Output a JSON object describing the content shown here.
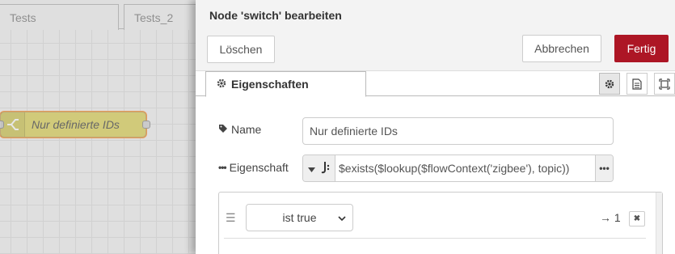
{
  "workspace": {
    "tabs": [
      {
        "label": "Tests"
      },
      {
        "label": "Tests_2"
      }
    ],
    "node": {
      "label": "Nur definierte IDs",
      "icon": "switch-icon"
    }
  },
  "editor": {
    "title": "Node 'switch' bearbeiten",
    "buttons": {
      "delete": "Löschen",
      "cancel": "Abbrechen",
      "done": "Fertig"
    },
    "tab": {
      "label": "Eigenschaften",
      "icon": "gear-icon"
    },
    "side_icons": [
      "gear-icon",
      "document-icon",
      "frame-icon"
    ],
    "fields": {
      "name": {
        "label": "Name",
        "icon": "tag-icon",
        "value": "Nur definierte IDs"
      },
      "property": {
        "label": "Eigenschaft",
        "icon": "ellipsis-icon",
        "type_icon": "jsonata-icon",
        "value": "$exists($lookup($flowContext('zigbee'), topic))"
      }
    },
    "rules": [
      {
        "operator": "ist true",
        "output": "→ 1"
      }
    ]
  },
  "colors": {
    "done_button": "#ad1625",
    "node_fill": "#e2d96e",
    "node_selected": "#ff9a3c"
  }
}
